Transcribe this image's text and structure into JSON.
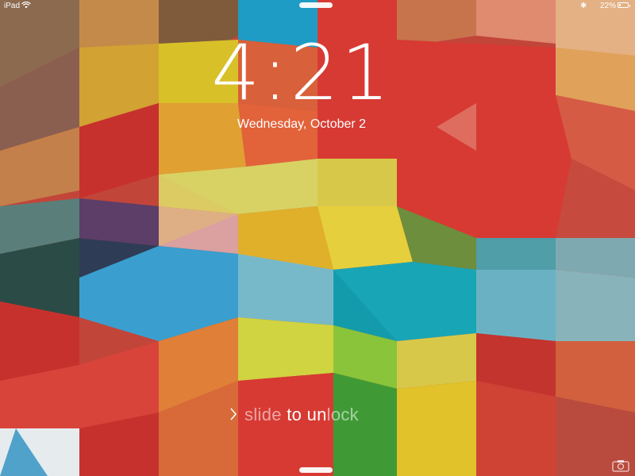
{
  "status_bar": {
    "carrier": "iPad",
    "battery": "22%",
    "battery_level": 0.22,
    "icons": [
      "wifi-icon",
      "bluetooth-icon",
      "battery-icon"
    ]
  },
  "lock_screen": {
    "time": "4:21",
    "date": "Wednesday, October 2",
    "slide_prefix": "slide ",
    "slide_highlight": "to un",
    "slide_suffix": "lock",
    "icons": [
      "chevron-right-icon",
      "camera-icon",
      "grabber-handle"
    ]
  },
  "colors": {
    "red": "#d73a33",
    "yellow": "#e5c41a",
    "teal": "#1fa7b2",
    "blue": "#4aa4cc",
    "green": "#3c9b35"
  }
}
